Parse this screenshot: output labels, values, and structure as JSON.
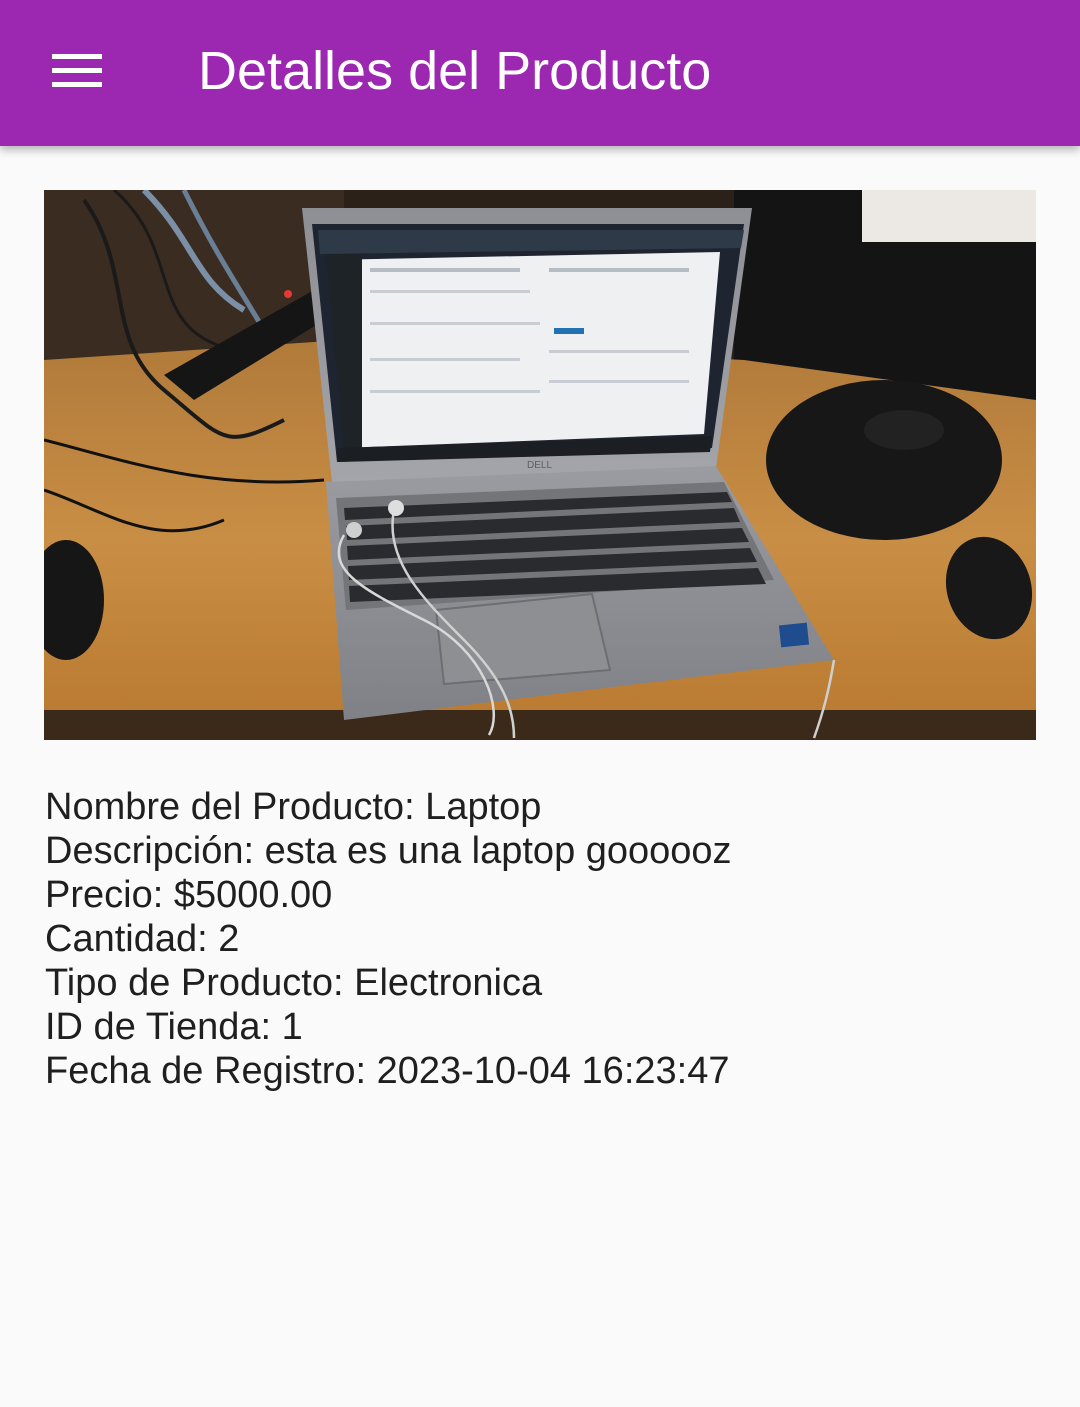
{
  "appbar": {
    "menu_icon": "hamburger-menu-icon",
    "title": "Detalles del Producto",
    "color": "#9c27b0"
  },
  "product_image": {
    "subject": "laptop photo",
    "screen_brand": "DELL",
    "keyboard_sticker": "intel core"
  },
  "details": {
    "nombre": "Nombre del Producto: Laptop",
    "descripcion": "Descripción: esta es una laptop goooooz",
    "precio": "Precio: $5000.00",
    "cantidad": "Cantidad: 2",
    "tipo": "Tipo de Producto: Electronica",
    "id_tienda": "ID de Tienda: 1",
    "fecha": "Fecha de Registro: 2023-10-04 16:23:47"
  }
}
